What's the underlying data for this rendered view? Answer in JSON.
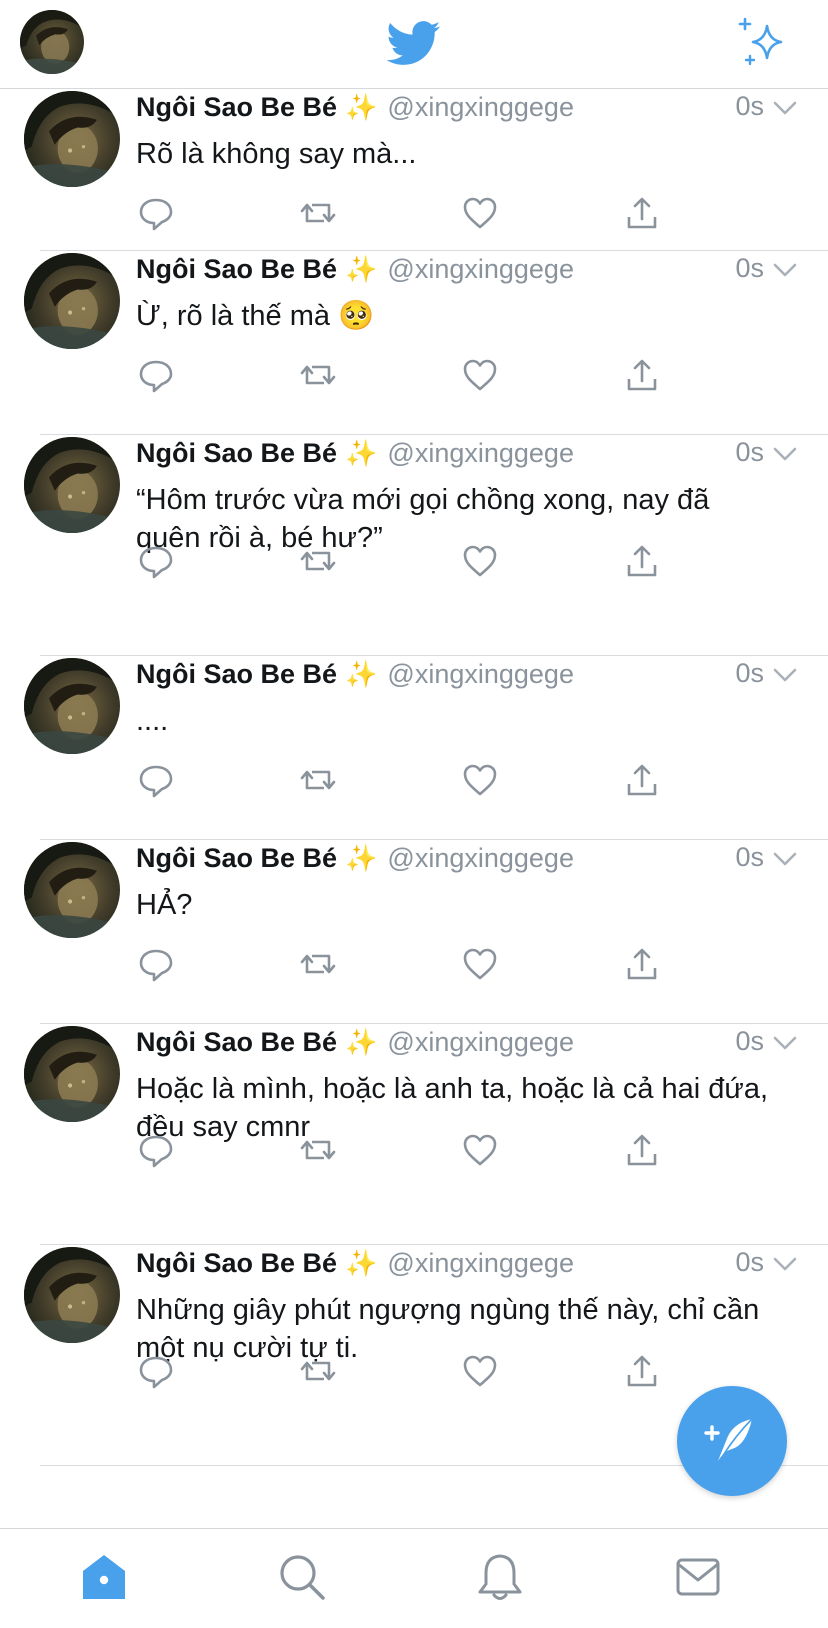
{
  "colors": {
    "accent": "#4aa1eb",
    "icon_gray": "#8a939c",
    "text": "#14171a",
    "divider": "#d9dcdf"
  },
  "header": {
    "avatar_icon": "profile-avatar",
    "logo_icon": "twitter-bird-icon",
    "sparkle_icon": "sparkle-icon"
  },
  "tweets": [
    {
      "name": "Ngôi Sao Be Bé",
      "badge": "✨",
      "handle": "@xingxinggege",
      "time": "0s",
      "text": "Rõ là không say mà..."
    },
    {
      "name": "Ngôi Sao Be Bé",
      "badge": "✨",
      "handle": "@xingxinggege",
      "time": "0s",
      "text": "Ừ, rõ là thế mà 🥺"
    },
    {
      "name": "Ngôi Sao Be Bé",
      "badge": "✨",
      "handle": "@xingxinggege",
      "time": "0s",
      "text": "“Hôm trước vừa mới gọi chồng xong, nay đã quên rồi à, bé hư?”"
    },
    {
      "name": "Ngôi Sao Be Bé",
      "badge": "✨",
      "handle": "@xingxinggege",
      "time": "0s",
      "text": "...."
    },
    {
      "name": "Ngôi Sao Be Bé",
      "badge": "✨",
      "handle": "@xingxinggege",
      "time": "0s",
      "text": "HẢ?"
    },
    {
      "name": "Ngôi Sao Be Bé",
      "badge": "✨",
      "handle": "@xingxinggege",
      "time": "0s",
      "text": "Hoặc là mình, hoặc là anh ta, hoặc là cả hai đứa, đều say cmnr"
    },
    {
      "name": "Ngôi Sao Be Bé",
      "badge": "✨",
      "handle": "@xingxinggege",
      "time": "0s",
      "text": "Những giây phút ngượng ngùng thế này, chỉ cần một nụ cười tự ti."
    }
  ],
  "action_icons": [
    "reply-icon",
    "retweet-icon",
    "like-icon",
    "share-icon"
  ],
  "fab": {
    "icon": "compose-feather-icon"
  },
  "bottom_nav": [
    "home-icon",
    "search-icon",
    "notifications-icon",
    "messages-icon"
  ]
}
